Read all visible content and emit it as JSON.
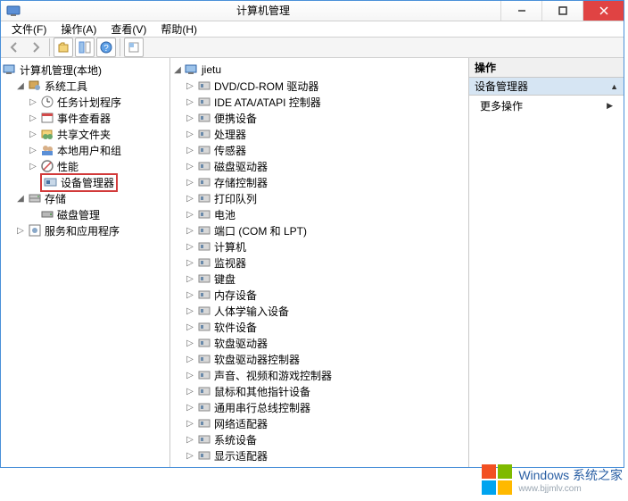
{
  "window": {
    "title": "计算机管理"
  },
  "menu": {
    "file": "文件(F)",
    "action": "操作(A)",
    "view": "查看(V)",
    "help": "帮助(H)"
  },
  "left": {
    "root": "计算机管理(本地)",
    "system_tools": "系统工具",
    "task_scheduler": "任务计划程序",
    "event_viewer": "事件查看器",
    "shared_folders": "共享文件夹",
    "local_users": "本地用户和组",
    "performance": "性能",
    "device_manager": "设备管理器",
    "storage": "存储",
    "disk_mgmt": "磁盘管理",
    "services": "服务和应用程序"
  },
  "mid": {
    "root": "jietu",
    "items": [
      "DVD/CD-ROM 驱动器",
      "IDE ATA/ATAPI 控制器",
      "便携设备",
      "处理器",
      "传感器",
      "磁盘驱动器",
      "存储控制器",
      "打印队列",
      "电池",
      "端口 (COM 和 LPT)",
      "计算机",
      "监视器",
      "键盘",
      "内存设备",
      "人体学输入设备",
      "软件设备",
      "软盘驱动器",
      "软盘驱动器控制器",
      "声音、视频和游戏控制器",
      "鼠标和其他指针设备",
      "通用串行总线控制器",
      "网络适配器",
      "系统设备",
      "显示适配器"
    ]
  },
  "right": {
    "header": "操作",
    "section": "设备管理器",
    "more": "更多操作"
  },
  "wm": {
    "brand": "Windows 系统之家",
    "url": "www.bjjmlv.com"
  }
}
